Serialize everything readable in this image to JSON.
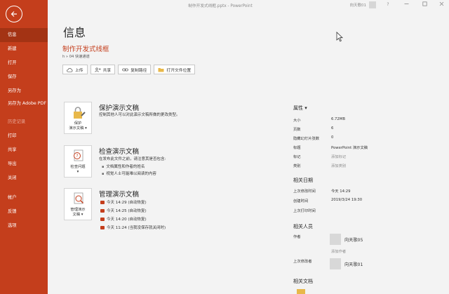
{
  "titlebar": {
    "title": "制作开发式线框.pptx - PowerPoint",
    "user": "向天歌01",
    "help_icon": "question-icon",
    "minimize_icon": "minimize-icon",
    "restore_icon": "restore-icon",
    "close_icon": "close-icon"
  },
  "sidebar": {
    "back_icon": "arrow-left-icon",
    "items": [
      {
        "label": "信息",
        "active": true
      },
      {
        "label": "新建"
      },
      {
        "label": "打开"
      },
      {
        "label": "保存"
      },
      {
        "label": "另存为"
      },
      {
        "label": "另存为 Adobe PDF"
      },
      {
        "label": "历史记录",
        "dim": true
      },
      {
        "label": "打印"
      },
      {
        "label": "共享"
      },
      {
        "label": "导出"
      },
      {
        "label": "关闭"
      },
      {
        "label": "帐户"
      },
      {
        "label": "反馈"
      },
      {
        "label": "选项"
      }
    ]
  },
  "main": {
    "page_title": "信息",
    "doc_name": "制作开发式线框",
    "doc_path": "h » 04 快速通道",
    "actions": [
      {
        "label": "上传",
        "icon": "upload-cloud-icon"
      },
      {
        "label": "共享",
        "icon": "share-icon"
      },
      {
        "label": "复制路径",
        "icon": "link-icon"
      },
      {
        "label": "打开文件位置",
        "icon": "folder-icon"
      }
    ],
    "protect": {
      "card_label_1": "保护",
      "card_label_2": "演示文稿",
      "title": "保护演示文稿",
      "desc": "控制其他人可以对此演示文稿所做的更改类型。"
    },
    "inspect": {
      "card_label_1": "检查问题",
      "title": "检查演示文稿",
      "desc": "在发布此文件之前，请注意其是否包含:",
      "bullets": [
        "文档属性和作者的姓名",
        "视觉人士可能难以阅读的内容"
      ]
    },
    "manage": {
      "card_label_1": "管理演示",
      "card_label_2": "文稿",
      "title": "管理演示文稿",
      "versions": [
        "今天 14:29 (自动恢复)",
        "今天 14:25 (自动恢复)",
        "今天 14:20 (自动恢复)",
        "今天 11:24 (当我没保存就关闭时)"
      ]
    }
  },
  "properties": {
    "header": "属性",
    "rows": [
      {
        "k": "大小",
        "v": "6.72MB"
      },
      {
        "k": "页数",
        "v": "6"
      },
      {
        "k": "隐藏幻灯片张数",
        "v": "0"
      },
      {
        "k": "标题",
        "v": "PowerPoint 演示文稿"
      },
      {
        "k": "标记",
        "v": "添加标记",
        "muted": true
      },
      {
        "k": "类别",
        "v": "添加类别",
        "muted": true
      }
    ],
    "dates_header": "相关日期",
    "dates": [
      {
        "k": "上次修改时间",
        "v": "今天 14:29"
      },
      {
        "k": "创建时间",
        "v": "2019/3/24 19:30"
      },
      {
        "k": "上次打印时间",
        "v": ""
      }
    ],
    "people_header": "相关人员",
    "author_label": "作者",
    "author": "向天歌05",
    "add_author": "添加作者",
    "last_modified_by_label": "上次修改者",
    "last_modified_by": "向天歌01",
    "docs_header": "相关文档"
  }
}
